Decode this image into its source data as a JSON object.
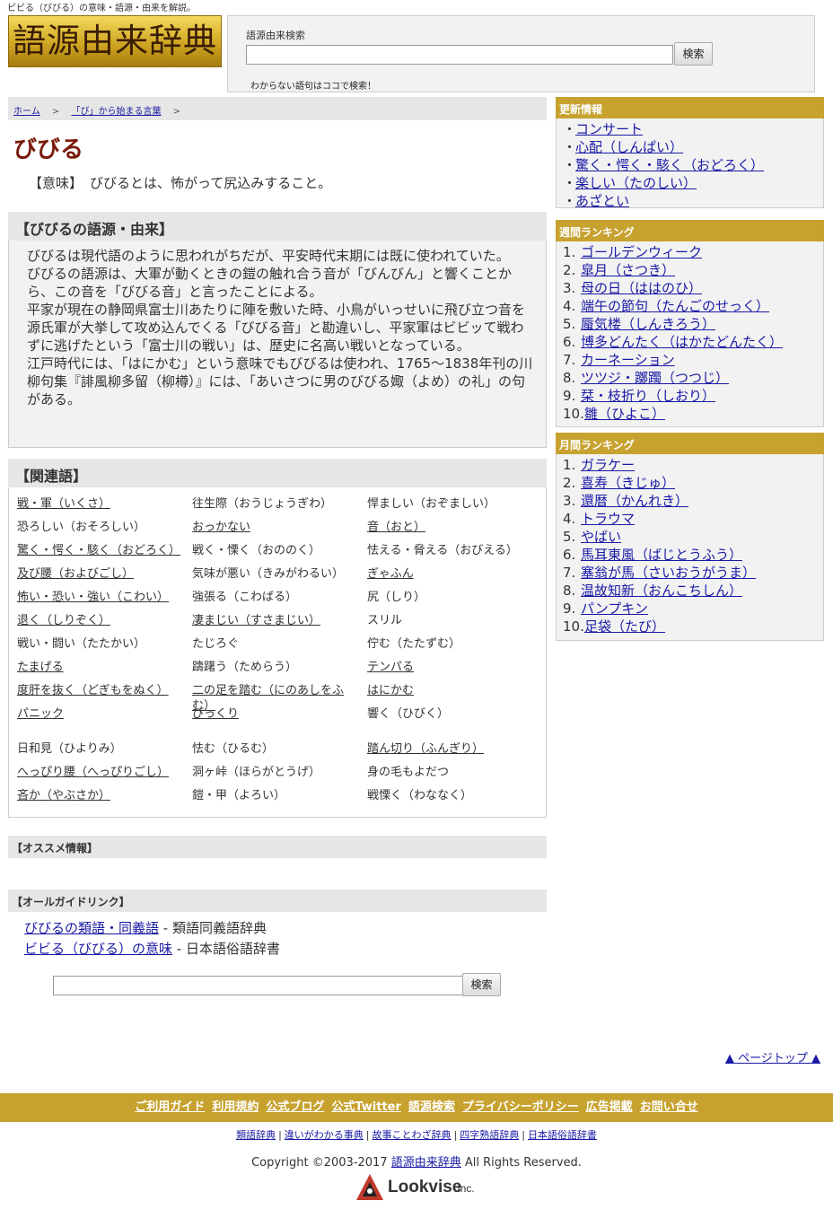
{
  "header": {
    "tagline": "ビビる（びびる）の意味・語源・由来を解説。",
    "logo_text": "語源由来辞典",
    "search_label": "語源由来検索",
    "search_value": "",
    "search_button": "検索",
    "search_hint": "わからない語句はココで検索！"
  },
  "breadcrumb": [
    "ホーム",
    ">",
    "「び」から始まる言葉",
    ">"
  ],
  "page_title": "びびる",
  "meaning": {
    "label": "【意味】",
    "text": "びびるとは、怖がって尻込みすること。"
  },
  "etymology": {
    "heading": "【びびるの語源・由来】",
    "paragraphs": [
      "びびるは現代語のように思われがちだが、平安時代末期には既に使われていた。",
      "びびるの語源は、大軍が動くときの鎧の触れ合う音が「びんびん」と響くことから、この音を「びびる音」と言ったことによる。",
      "平家が現在の静岡県富士川あたりに陣を敷いた時、小鳥がいっせいに飛び立つ音を源氏軍が大挙して攻め込んでくる「びびる音」と勘違いし、平家軍はビビッて戦わずに逃げたという「富士川の戦い」は、歴史に名高い戦いとなっている。",
      "江戸時代には、「はにかむ」という意味でもびびるは使われ、1765～1838年刊の川柳句集『誹風柳多留（柳樽）』には、「あいさつに男のびびる娵（よめ）の礼」の句がある。"
    ]
  },
  "related": {
    "heading": "【関連語】",
    "items": [
      {
        "text": "戦・軍（いくさ）",
        "link": true
      },
      {
        "text": "往生際（おうじょうぎわ）",
        "link": false
      },
      {
        "text": "悍ましい（おぞましい）",
        "link": false
      },
      {
        "text": "恐ろしい（おそろしい）",
        "link": false
      },
      {
        "text": "おっかない",
        "link": true
      },
      {
        "text": "音（おと）",
        "link": true
      },
      {
        "text": "驚く・愕く・駭く（おどろく）",
        "link": true
      },
      {
        "text": "戦く・慄く（おののく）",
        "link": false
      },
      {
        "text": "怯える・脅える（おびえる）",
        "link": false
      },
      {
        "text": "及び腰（およびごし）",
        "link": true
      },
      {
        "text": "気味が悪い（きみがわるい）",
        "link": false
      },
      {
        "text": "ぎゃふん",
        "link": true
      },
      {
        "text": "怖い・恐い・強い（こわい）",
        "link": true
      },
      {
        "text": "強張る（こわばる）",
        "link": false
      },
      {
        "text": "尻（しり）",
        "link": false
      },
      {
        "text": "退く（しりぞく）",
        "link": true
      },
      {
        "text": "凄まじい（すさまじい）",
        "link": true
      },
      {
        "text": "スリル",
        "link": false
      },
      {
        "text": "戦い・闘い（たたかい）",
        "link": false
      },
      {
        "text": "たじろぐ",
        "link": false
      },
      {
        "text": "佇む（たたずむ）",
        "link": false
      },
      {
        "text": "たまげる",
        "link": true
      },
      {
        "text": "躊躇う（ためらう）",
        "link": false
      },
      {
        "text": "テンパる",
        "link": true
      },
      {
        "text": "度肝を抜く（どぎもをぬく）",
        "link": true
      },
      {
        "text": "二の足を踏む（にのあしをふむ）",
        "link": true
      },
      {
        "text": "はにかむ",
        "link": true
      },
      {
        "text": "パニック",
        "link": true
      },
      {
        "text": "びっくり",
        "link": true
      },
      {
        "text": "響く（ひびく）",
        "link": false
      },
      {
        "text": "日和見（ひよりみ）",
        "link": false
      },
      {
        "text": "怯む（ひるむ）",
        "link": false
      },
      {
        "text": "踏ん切り（ふんぎり）",
        "link": true
      },
      {
        "text": "へっぴり腰（へっぴりごし）",
        "link": true
      },
      {
        "text": "洞ヶ峠（ほらがとうげ）",
        "link": false
      },
      {
        "text": "身の毛もよだつ",
        "link": false
      },
      {
        "text": "吝か（やぶさか）",
        "link": true
      },
      {
        "text": "鎧・甲（よろい）",
        "link": false
      },
      {
        "text": "戦慄く（わななく）",
        "link": false
      }
    ]
  },
  "osusume": {
    "heading": "【オススメ情報】"
  },
  "guide": {
    "heading": "【オールガイドリンク】",
    "links": [
      {
        "link": "びびるの類語・同義語",
        "suffix": " - 類語同義語辞典"
      },
      {
        "link": "ビビる（びびる）の意味",
        "suffix": " - 日本語俗語辞書"
      }
    ]
  },
  "bottom_search": {
    "value": "",
    "button": "検索"
  },
  "pagetop": "▲ ページトップ ▲",
  "sidebar": {
    "updates": {
      "heading": "更新情報",
      "items": [
        "コンサート",
        "心配（しんぱい）",
        "驚く・愕く・駭く（おどろく）",
        "楽しい（たのしい）",
        "あざとい"
      ]
    },
    "weekly": {
      "heading": "週間ランキング",
      "items": [
        "ゴールデンウィーク",
        "皐月（さつき）",
        "母の日（ははのひ）",
        "端午の節句（たんごのせっく）",
        "蜃気楼（しんきろう）",
        "博多どんたく（はかたどんたく）",
        "カーネーション",
        "ツツジ・躑躅（つつじ）",
        "栞・枝折り（しおり）",
        "雛（ひよこ）"
      ]
    },
    "monthly": {
      "heading": "月間ランキング",
      "items": [
        "ガラケー",
        "喜寿（きじゅ）",
        "還暦（かんれき）",
        "トラウマ",
        "やばい",
        "馬耳東風（ばじとうふう）",
        "塞翁が馬（さいおうがうま）",
        "温故知新（おんこちしん）",
        "パンプキン",
        "足袋（たび）"
      ]
    }
  },
  "footer": {
    "links": [
      "ご利用ガイド",
      "利用規約",
      "公式ブログ",
      "公式Twitter",
      "語源検索",
      "プライバシーポリシー",
      "広告掲載",
      "お問い合せ"
    ],
    "dicts": [
      "類語辞典",
      "違いがわかる事典",
      "故事ことわざ辞典",
      "四字熟語辞典",
      "日本語俗語辞書"
    ],
    "copyright_prefix": "Copyright ©2003-2017 ",
    "copyright_link": "語源由来辞典",
    "copyright_suffix": " All Rights Reserved.",
    "company": "Lookvise",
    "company_suffix": ".Inc."
  }
}
